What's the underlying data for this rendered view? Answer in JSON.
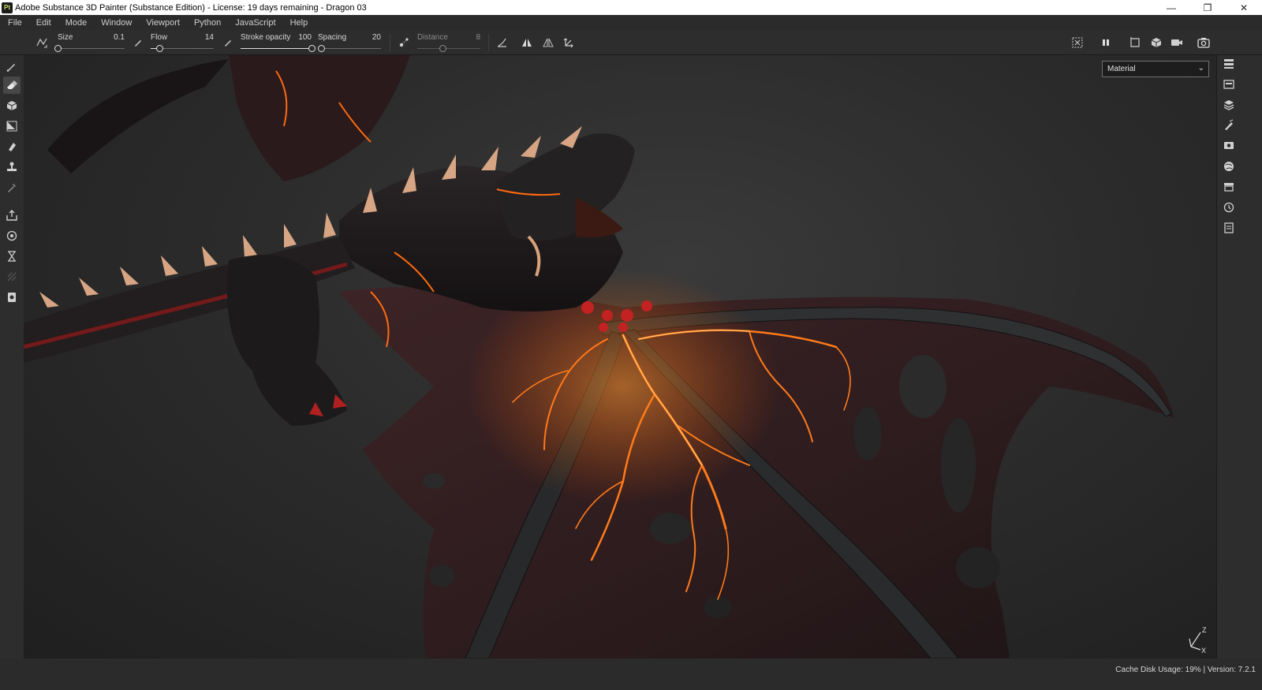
{
  "window": {
    "logo_text": "Pt",
    "title": "Adobe Substance 3D Painter (Substance Edition) - License: 19 days remaining - Dragon 03",
    "controls": {
      "minimize": "—",
      "restore": "❐",
      "close": "✕"
    }
  },
  "menubar": {
    "items": [
      "File",
      "Edit",
      "Mode",
      "Window",
      "Viewport",
      "Python",
      "JavaScript",
      "Help"
    ]
  },
  "toolbar": {
    "size": {
      "label": "Size",
      "value": "0.1",
      "level": 0.0
    },
    "flow": {
      "label": "Flow",
      "value": "14",
      "level": 0.14
    },
    "stroke_opacity": {
      "label": "Stroke opacity",
      "value": "100",
      "level": 1.0
    },
    "spacing": {
      "label": "Spacing",
      "value": "20",
      "level": 0.05
    },
    "distance": {
      "label": "Distance",
      "value": "8",
      "level": 0.4
    }
  },
  "viewport": {
    "channel": "Material",
    "axis": {
      "z": "Z",
      "x": "X"
    }
  },
  "statusbar": {
    "cache": "Cache Disk Usage:   19% | Version: 7.2.1"
  },
  "colors": {
    "lava": "#ff7a1a",
    "lava_core": "#ffb347",
    "dragon_dark": "#1b1718",
    "wing_membrane": "#3a2224",
    "panel_bg": "#2d2d2d"
  }
}
